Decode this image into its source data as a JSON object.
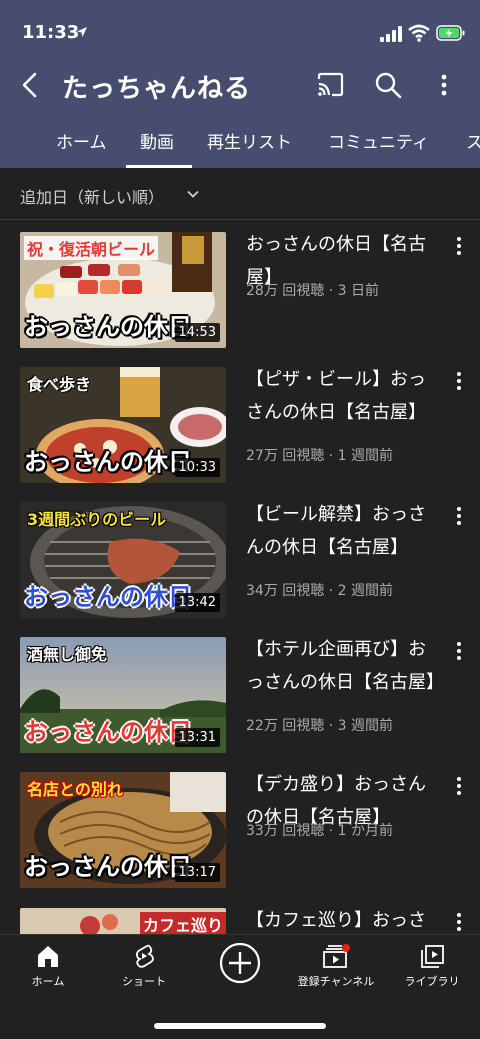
{
  "status": {
    "time": "11:33"
  },
  "topbar": {
    "title": "たっちゃんねる"
  },
  "tabs": [
    "ホーム",
    "動画",
    "再生リスト",
    "コミュニティ",
    "ス"
  ],
  "sort": {
    "label": "追加日（新しい順）"
  },
  "videos": [
    {
      "title": "おっさんの休日【名古屋】",
      "meta": "28万 回視聴 · 3 日前",
      "duration": "14:53",
      "caption_top": "祝・復活朝ビール",
      "caption_main": "おっさんの休日"
    },
    {
      "title": "【ピザ・ビール】おっさんの休日【名古屋】",
      "meta": "27万 回視聴 · 1 週間前",
      "duration": "10:33",
      "caption_top": "食べ歩き",
      "caption_main": "おっさんの休日"
    },
    {
      "title": "【ビール解禁】おっさんの休日【名古屋】",
      "meta": "34万 回視聴 · 2 週間前",
      "duration": "13:42",
      "caption_top": "3週間ぶりのビール",
      "caption_main": "おっさんの休日"
    },
    {
      "title": "【ホテル企画再び】おっさんの休日【名古屋】",
      "meta": "22万 回視聴 · 3 週間前",
      "duration": "13:31",
      "caption_top": "酒無し御免",
      "caption_main": "おっさんの休日"
    },
    {
      "title": "【デカ盛り】おっさんの休日【名古屋】",
      "meta": "33万 回視聴 · 1 か月前",
      "duration": "13:17",
      "caption_top": "名店との別れ",
      "caption_main": "おっさんの休日"
    },
    {
      "title": "【カフェ巡り】おっさんの休日",
      "meta": "",
      "duration": "",
      "caption_top": "カフェ巡り",
      "caption_main": ""
    }
  ],
  "bottom_nav": [
    {
      "label": "ホーム",
      "icon": "home-icon"
    },
    {
      "label": "ショート",
      "icon": "shorts-icon"
    },
    {
      "label": "",
      "icon": "create-icon"
    },
    {
      "label": "登録チャンネル",
      "icon": "subscriptions-icon"
    },
    {
      "label": "ライブラリ",
      "icon": "library-icon"
    }
  ],
  "colors": {
    "header_bg": "#474d6e",
    "body_bg": "#212121",
    "meta_text": "#aaaaaa",
    "notification_dot": "#e62117"
  }
}
